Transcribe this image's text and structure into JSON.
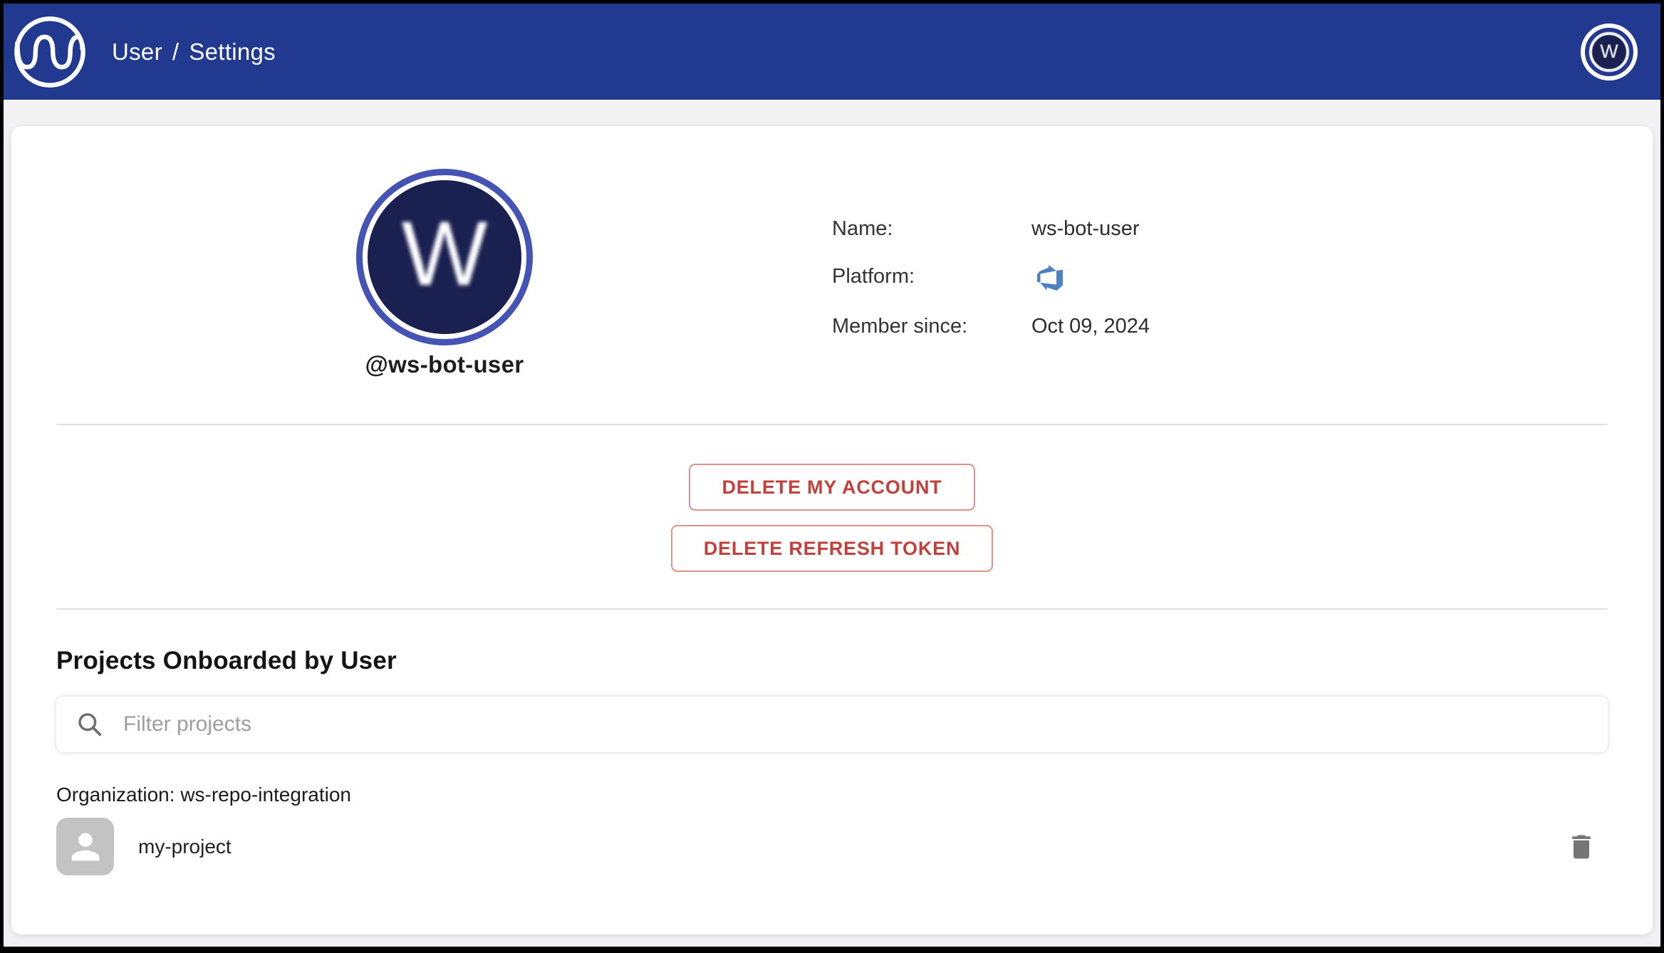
{
  "header": {
    "logo": "wave-logo",
    "breadcrumb": {
      "item1": "User",
      "separator": "/",
      "item2": "Settings"
    },
    "avatar_initial": "W"
  },
  "profile": {
    "avatar_initial": "W",
    "handle": "@ws-bot-user",
    "details": {
      "name_label": "Name:",
      "name_value": "ws-bot-user",
      "platform_label": "Platform:",
      "platform_icon": "azure-devops-icon",
      "member_label": "Member since:",
      "member_value": "Oct 09, 2024"
    }
  },
  "actions": {
    "delete_account_label": "DELETE MY ACCOUNT",
    "delete_refresh_label": "DELETE REFRESH TOKEN"
  },
  "projects": {
    "heading": "Projects Onboarded by User",
    "filter_placeholder": "Filter projects",
    "organization_label": "Organization: ws-repo-integration",
    "items": [
      {
        "name": "my-project"
      }
    ]
  },
  "colors": {
    "header_navy": "#21398e",
    "avatar_ring_indigo": "#4553b4",
    "avatar_disc_navy": "#1a2151",
    "danger_red": "#c2413c",
    "danger_border": "#df928e",
    "divider_gray": "#e1e1e1",
    "placeholder_gray": "#9e9e9e",
    "icon_gray": "#757575",
    "project_avatar_gray": "#c3c3c3",
    "page_bg": "#f2f2f4",
    "azure_devops_blue": "#4e80c4"
  }
}
